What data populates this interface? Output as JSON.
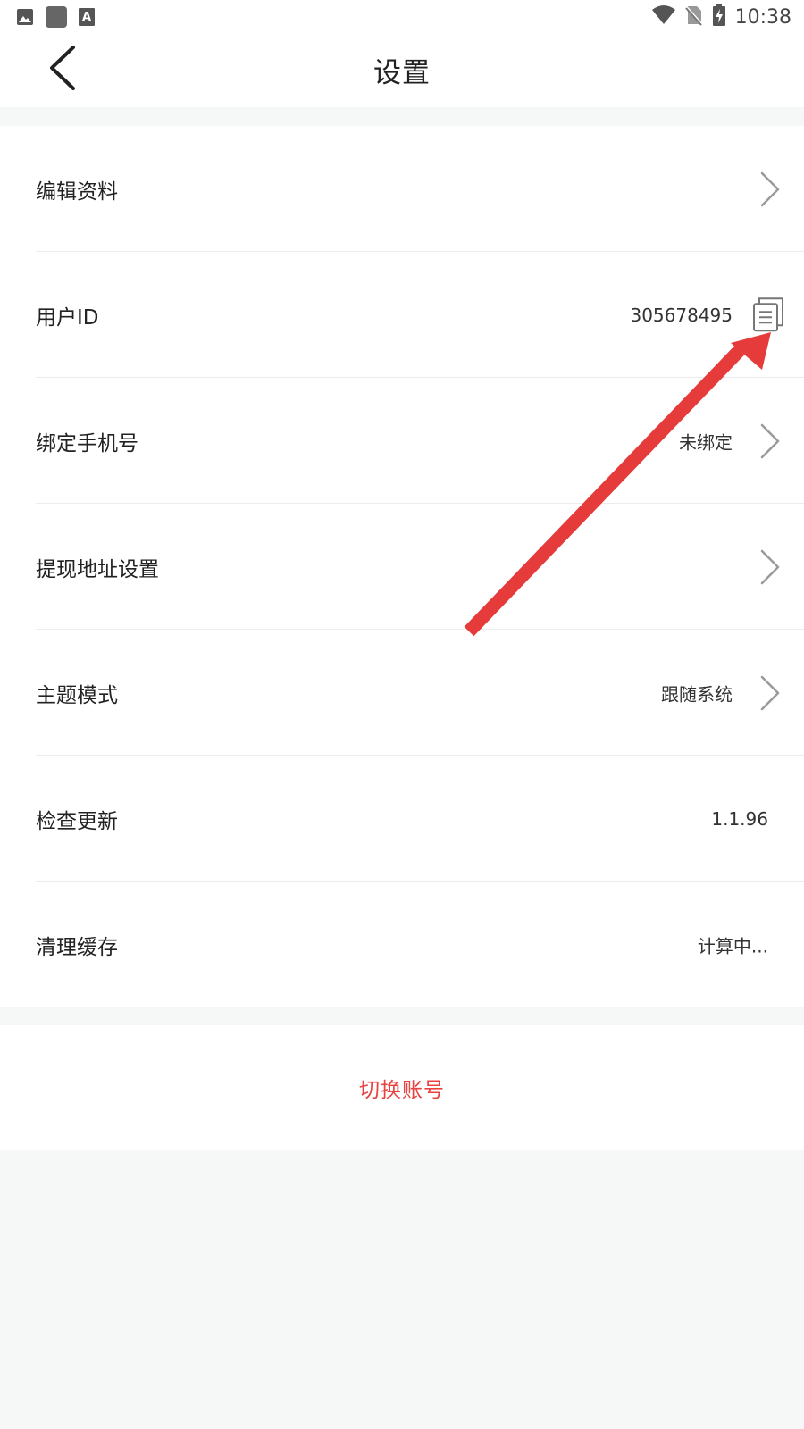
{
  "status_bar": {
    "time": "10:38",
    "left_icons": [
      "image-icon",
      "square-notification-icon",
      "text-a-icon"
    ],
    "right_icons": [
      "wifi-icon",
      "no-sim-icon",
      "battery-charging-icon"
    ]
  },
  "header": {
    "title": "设置",
    "back_icon": "chevron-left-icon"
  },
  "settings": {
    "edit_profile": {
      "label": "编辑资料"
    },
    "user_id": {
      "label": "用户ID",
      "value": "305678495",
      "action_icon": "copy-icon"
    },
    "bind_phone": {
      "label": "绑定手机号",
      "value": "未绑定"
    },
    "withdraw_address": {
      "label": "提现地址设置"
    },
    "theme_mode": {
      "label": "主题模式",
      "value": "跟随系统"
    },
    "check_update": {
      "label": "检查更新",
      "value": "1.1.96"
    },
    "clear_cache": {
      "label": "清理缓存",
      "value": "计算中..."
    }
  },
  "switch_account": {
    "label": "切换账号"
  },
  "colors": {
    "accent_red": "#e84341",
    "background": "#f6f7f7",
    "card": "#ffffff",
    "annotation_arrow": "#e63b3b"
  }
}
